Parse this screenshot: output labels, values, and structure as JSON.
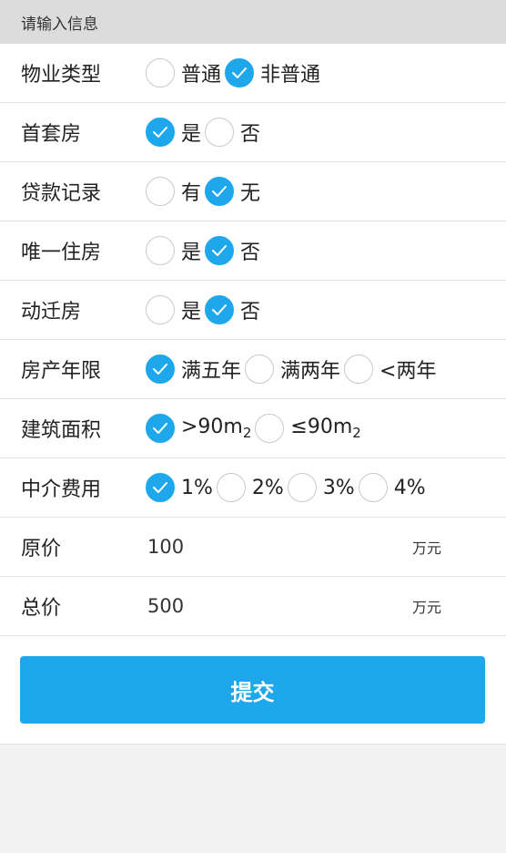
{
  "header": {
    "title": "请输入信息"
  },
  "rows": [
    {
      "label": "物业类型",
      "options": [
        {
          "text": "普通",
          "checked": false
        },
        {
          "text": "非普通",
          "checked": true
        }
      ]
    },
    {
      "label": "首套房",
      "options": [
        {
          "text": "是",
          "checked": true
        },
        {
          "text": "否",
          "checked": false
        }
      ]
    },
    {
      "label": "贷款记录",
      "options": [
        {
          "text": "有",
          "checked": false
        },
        {
          "text": "无",
          "checked": true
        }
      ]
    },
    {
      "label": "唯一住房",
      "options": [
        {
          "text": "是",
          "checked": false
        },
        {
          "text": "否",
          "checked": true
        }
      ]
    },
    {
      "label": "动迁房",
      "options": [
        {
          "text": "是",
          "checked": false
        },
        {
          "text": "否",
          "checked": true
        }
      ]
    },
    {
      "label": "房产年限",
      "options": [
        {
          "text": "满五年",
          "checked": true
        },
        {
          "text": "满两年",
          "checked": false
        },
        {
          "text": "<两年",
          "checked": false
        }
      ]
    },
    {
      "label": "建筑面积",
      "options": [
        {
          "text": ">90m",
          "sub": "2",
          "checked": true
        },
        {
          "text": "≤90m",
          "sub": "2",
          "checked": false
        }
      ]
    },
    {
      "label": "中介费用",
      "options": [
        {
          "text": "1%",
          "checked": true
        },
        {
          "text": "2%",
          "checked": false
        },
        {
          "text": "3%",
          "checked": false
        },
        {
          "text": "4%",
          "checked": false
        }
      ]
    }
  ],
  "original_price": {
    "label": "原价",
    "value": "100",
    "unit": "万元"
  },
  "total_price": {
    "label": "总价",
    "value": "500",
    "unit": "万元"
  },
  "submit": {
    "label": "提交"
  },
  "colors": {
    "accent": "#1fa7ec",
    "header_bg": "#dcdcdc",
    "page_bg": "#f2f2f2"
  },
  "icons": {
    "checked": "checkmark-icon"
  }
}
